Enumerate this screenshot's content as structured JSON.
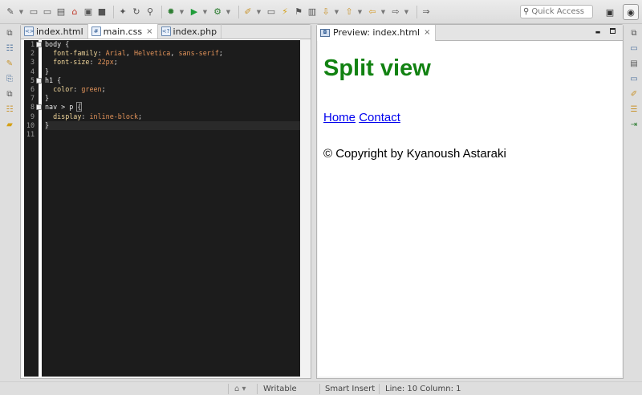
{
  "toolbar": {
    "quick_access_placeholder": "Quick Access"
  },
  "editor": {
    "tabs": [
      {
        "label": "index.html",
        "closable": false
      },
      {
        "label": "main.css",
        "closable": true
      },
      {
        "label": "index.php",
        "closable": false
      }
    ],
    "close_glyph": "×",
    "line_numbers": [
      "1",
      "2",
      "3",
      "4",
      "5",
      "6",
      "7",
      "8",
      "9",
      "10",
      "11"
    ],
    "code": {
      "l1_selector": "body",
      "l1_brace": " {",
      "l2_prop": "  font-family",
      "l2_colon": ": ",
      "l2_v1": "Arial",
      "l2_c1": ", ",
      "l2_v2": "Helvetica",
      "l2_c2": ", ",
      "l2_v3": "sans-serif",
      "l2_end": ";",
      "l3_prop": "  font-size",
      "l3_colon": ": ",
      "l3_val": "22px",
      "l3_end": ";",
      "l4": "}",
      "l5_selector": "h1",
      "l5_brace": " {",
      "l6_prop": "  color",
      "l6_colon": ": ",
      "l6_val": "green",
      "l6_end": ";",
      "l7": "}",
      "l8_selector": "nav > p ",
      "l8_brace": "{",
      "l9_prop": "  display",
      "l9_colon": ": ",
      "l9_val": "inline-block",
      "l9_end": ";",
      "l10": "}",
      "l11": ""
    }
  },
  "preview": {
    "tab_label": "Preview: index.html",
    "heading": "Split view",
    "nav_links": [
      "Home",
      "Contact"
    ],
    "footer": "© Copyright by Kyanoush Astaraki",
    "minimize_glyph": "▬",
    "heading_color": "#128212"
  },
  "status": {
    "writable": "Writable",
    "insert_mode": "Smart Insert",
    "position": "Line: 10 Column: 1"
  }
}
